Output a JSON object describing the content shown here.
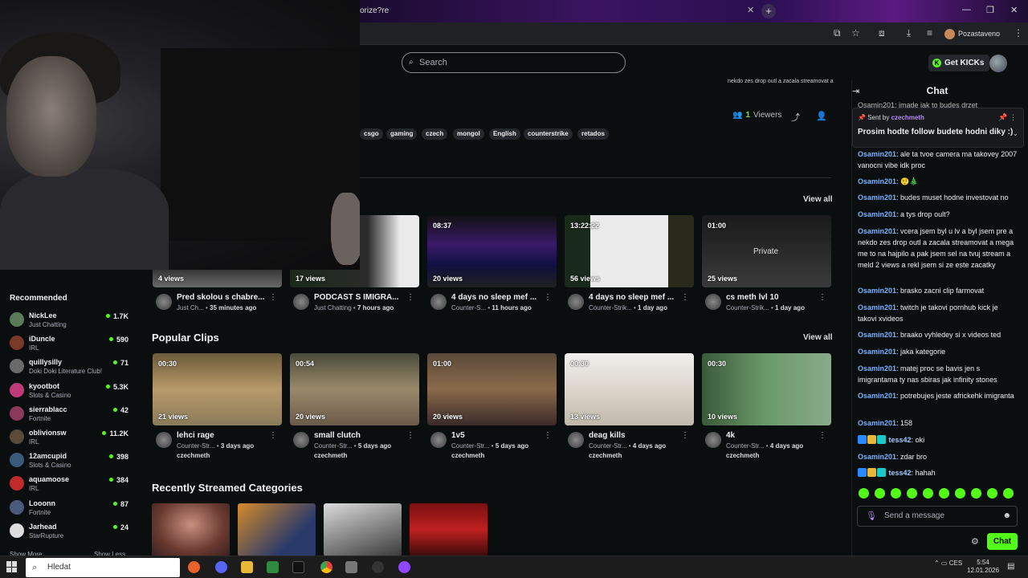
{
  "browser": {
    "tab_title": "orize?re",
    "tab_close": "✕",
    "new_tab": "+",
    "profile_label": "Pozastaveno",
    "window_controls": [
      "—",
      "❐",
      "✕"
    ]
  },
  "header": {
    "search_placeholder": "Search",
    "get_kicks_label": "Get KICKs"
  },
  "stream": {
    "viewers_count": "1",
    "viewers_label": "Viewers",
    "tags": [
      "csgo",
      "gaming",
      "czech",
      "mongol",
      "English",
      "counterstrike",
      "retados"
    ],
    "top_snippet": "nekdo zes drop outl a zacala streamovat a"
  },
  "videos_section": {
    "view_all": "View all",
    "cards": [
      {
        "duration": "",
        "views": "4 views",
        "title": "Pred skolou s chabre...",
        "category": "Just Ch...",
        "age": "35 minutes ago",
        "channel": ""
      },
      {
        "duration": "",
        "views": "17 views",
        "title": "PODCAST S IMIGRA...",
        "category": "Just Chatting",
        "age": "7 hours ago",
        "channel": ""
      },
      {
        "duration": "08:37",
        "views": "20 views",
        "title": "4 days no sleep mef ...",
        "category": "Counter-S...",
        "age": "11 hours ago",
        "channel": ""
      },
      {
        "duration": "13:22:22",
        "views": "56 views",
        "title": "4 days no sleep mef ...",
        "category": "Counter-Strik...",
        "age": "1 day ago",
        "channel": ""
      },
      {
        "duration": "01:00",
        "views": "25 views",
        "title": "cs meth lvl 10",
        "category": "Counter-Strik...",
        "age": "1 day ago",
        "channel": "",
        "private": "Private"
      }
    ]
  },
  "clips_section": {
    "title": "Popular Clips",
    "view_all": "View all",
    "cards": [
      {
        "duration": "00:30",
        "views": "21 views",
        "title": "lehci rage",
        "category": "Counter-Str...",
        "age": "3 days ago",
        "channel": "czechmeth"
      },
      {
        "duration": "00:54",
        "views": "20 views",
        "title": "small clutch",
        "category": "Counter-Str...",
        "age": "5 days ago",
        "channel": "czechmeth"
      },
      {
        "duration": "01:00",
        "views": "20 views",
        "title": "1v5",
        "category": "Counter-Str...",
        "age": "5 days ago",
        "channel": "czechmeth"
      },
      {
        "duration": "00:30",
        "views": "13 views",
        "title": "deag kills",
        "category": "Counter-Str...",
        "age": "4 days ago",
        "channel": "czechmeth"
      },
      {
        "duration": "00:30",
        "views": "10 views",
        "title": "4k",
        "category": "Counter-Str...",
        "age": "4 days ago",
        "channel": "czechmeth"
      }
    ]
  },
  "categories_section": {
    "title": "Recently Streamed Categories"
  },
  "sidebar": {
    "recommended_title": "Recommended",
    "items": [
      {
        "name": "NickLee",
        "category": "Just Chatting",
        "viewers": "1.7K",
        "color": "#5a7a5a"
      },
      {
        "name": "iDuncle",
        "category": "IRL",
        "viewers": "590",
        "color": "#7a3a2a"
      },
      {
        "name": "quillysilly",
        "category": "Doki Doki Literature Club!",
        "viewers": "71",
        "color": "#6a6a6a"
      },
      {
        "name": "kyootbot",
        "category": "Slots & Casino",
        "viewers": "5.3K",
        "color": "#c03a7a"
      },
      {
        "name": "sierrablacc",
        "category": "Fortnite",
        "viewers": "42",
        "color": "#8a3a5a"
      },
      {
        "name": "oblivionsw",
        "category": "IRL",
        "viewers": "11.2K",
        "color": "#5a4a3a"
      },
      {
        "name": "12amcupid",
        "category": "Slots & Casino",
        "viewers": "398",
        "color": "#3a5a7a"
      },
      {
        "name": "aquamoose",
        "category": "IRL",
        "viewers": "384",
        "color": "#c02a2a"
      },
      {
        "name": "Looonn",
        "category": "Fortnite",
        "viewers": "87",
        "color": "#4a5a7a"
      },
      {
        "name": "Jarhead",
        "category": "StarRupture",
        "viewers": "24",
        "color": "#dddddd"
      }
    ],
    "show_more": "Show More",
    "show_less": "Show Less"
  },
  "chat": {
    "title": "Chat",
    "pinned_sent_by": "Sent by",
    "pinned_user": "czechmeth",
    "pinned_message": "Prosim hodte follow budete hodni diky :)",
    "partial_top": "Osamin201: imade jak to budes drzet",
    "messages": [
      {
        "user": "Osamin201",
        "text": "ale ta tvoe camera ma takovey 2007 vanocni vibe idk proc"
      },
      {
        "user": "Osamin201",
        "text": "🤨🎄"
      },
      {
        "user": "Osamin201",
        "text": "budes muset hodne investovat no"
      },
      {
        "user": "Osamin201",
        "text": "a tys drop oult?"
      },
      {
        "user": "Osamin201",
        "text": "vcera jsem byl u lv a byl jsem pre a nekdo zes drop outl a zacala streamovat a mega me to na hajpilo a pak jsem sel na tvuj stream a meld 2 views a rekl jsem si ze este zacatky"
      },
      {
        "user": "Osamin201",
        "text": "brasko zacni clip farmovat"
      },
      {
        "user": "Osamin201",
        "text": "twitch je takovi pornhub kick je takovi xvideos"
      },
      {
        "user": "Osamin201",
        "text": "braako vyhledey si x videos ted"
      },
      {
        "user": "Osamin201",
        "text": "jaka kategorie"
      },
      {
        "user": "Osamin201",
        "text": "matej proc se bavis jen s imigrantama ty nas sbiras jak infinity stones"
      },
      {
        "user": "Osamin201",
        "text": "potrebujes jeste africkehk imigranta"
      },
      {
        "user": "Osamin201",
        "text": "158"
      },
      {
        "user": "tess42",
        "text": "oki",
        "badges": true
      },
      {
        "user": "Osamin201",
        "text": "zdar bro"
      },
      {
        "user": "tess42",
        "text": "hahah",
        "badges": true
      }
    ],
    "input_placeholder": "Send a message",
    "send_label": "Chat"
  },
  "taskbar": {
    "search_placeholder": "Hledat",
    "lang": "CES",
    "time": "5:54",
    "date": "12.01.2026"
  },
  "colors": {
    "accent": "#53fc18",
    "chat_user": "#74b4ff"
  }
}
